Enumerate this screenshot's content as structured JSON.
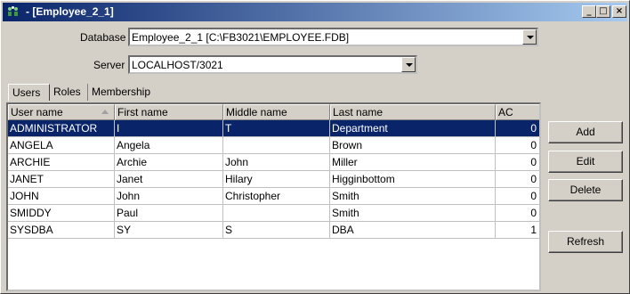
{
  "window": {
    "title": "- [Employee_2_1]",
    "minimize": "_",
    "maximize": "□",
    "close": "×"
  },
  "form": {
    "database_label": "Database",
    "database_value": "Employee_2_1 [C:\\FB3021\\EMPLOYEE.FDB]",
    "server_label": "Server",
    "server_value": "LOCALHOST/3021"
  },
  "tabs": [
    {
      "label": "Users"
    },
    {
      "label": "Roles"
    },
    {
      "label": "Membership"
    }
  ],
  "table": {
    "columns": [
      "User name",
      "First name",
      "Middle name",
      "Last name",
      "AC"
    ],
    "rows": [
      [
        "ADMINISTRATOR",
        "I",
        "T",
        "Department",
        "0"
      ],
      [
        "ANGELA",
        "Angela",
        "",
        "Brown",
        "0"
      ],
      [
        "ARCHIE",
        "Archie",
        "John",
        "Miller",
        "0"
      ],
      [
        "JANET",
        "Janet",
        "Hilary",
        "Higginbottom",
        "0"
      ],
      [
        "JOHN",
        "John",
        "Christopher",
        "Smith",
        "0"
      ],
      [
        "SMIDDY",
        "Paul",
        "",
        "Smith",
        "0"
      ],
      [
        "SYSDBA",
        "SY",
        "S",
        "DBA",
        "1"
      ]
    ]
  },
  "buttons": {
    "add": "Add",
    "edit": "Edit",
    "delete": "Delete",
    "refresh": "Refresh"
  },
  "colors": {
    "selection": "#0a246a",
    "titlebar_start": "#0a246a",
    "titlebar_end": "#a6caf0"
  }
}
